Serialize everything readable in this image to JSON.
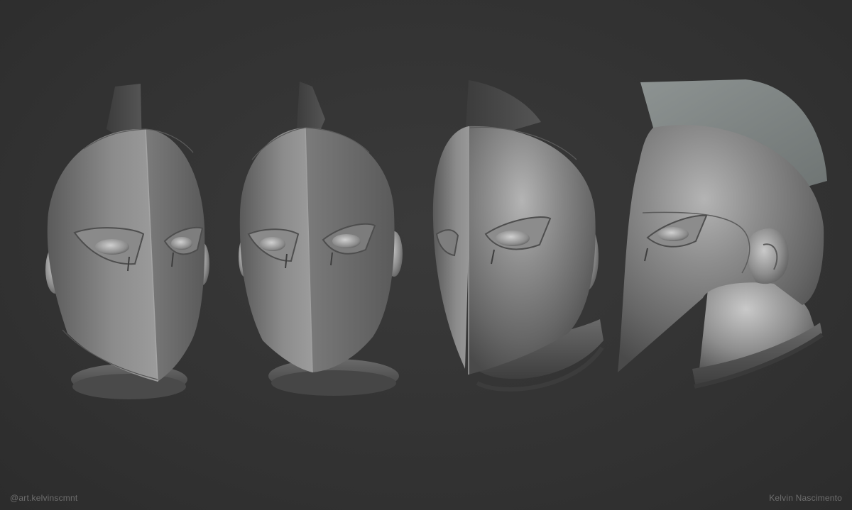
{
  "scene": {
    "background_color": "#333333",
    "material_color": "#8a8a8a",
    "views": [
      {
        "name": "front"
      },
      {
        "name": "front three-quarter"
      },
      {
        "name": "three-quarter"
      },
      {
        "name": "side profile"
      }
    ]
  },
  "watermarks": {
    "handle": "@art.kelvinscmnt",
    "artist": "Kelvin Nascimento"
  }
}
